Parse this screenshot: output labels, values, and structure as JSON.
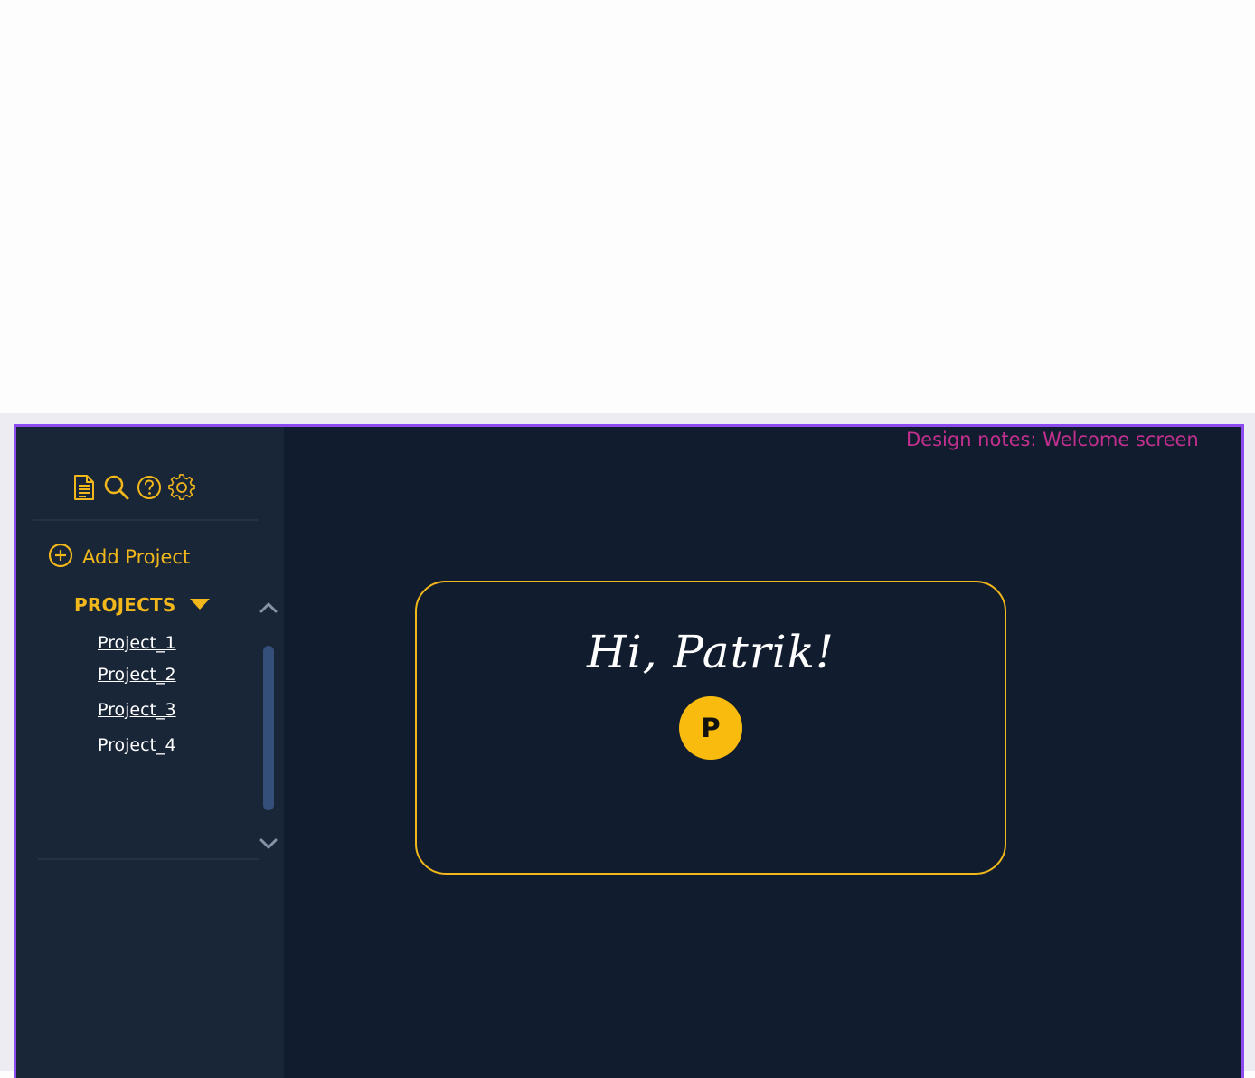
{
  "sidebar": {
    "toolbar": {
      "icons": [
        "document-icon",
        "search-icon",
        "help-icon",
        "settings-icon"
      ]
    },
    "add_project_label": "Add Project",
    "projects_header": "PROJECTS",
    "projects": [
      {
        "label": "Project_1"
      },
      {
        "label": "Project_2"
      },
      {
        "label": "Project_3"
      },
      {
        "label": "Project_4"
      }
    ]
  },
  "main": {
    "design_notes": "Design notes: Welcome screen",
    "greeting": "Hi, Patrik!",
    "avatar_initial": "P"
  },
  "colors": {
    "accent": "#f2b71b",
    "frame_border": "#8c4cf0",
    "main_bg": "#111d2e",
    "sidebar_bg": "#192638",
    "notes_text": "#c22f8f",
    "scrollbar": "#34507a"
  }
}
